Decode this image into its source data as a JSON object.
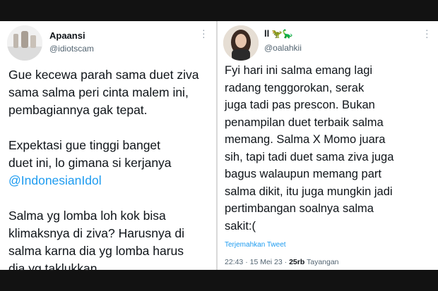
{
  "left_tweet": {
    "name": "Apaansi",
    "handle": "@idiotscam",
    "more_icon": "more-vertical-icon",
    "paragraphs": {
      "p1": [
        "Gue kecewa parah sama duet ziva",
        "sama salma peri cinta malem ini,",
        "pembagiannya gak tepat."
      ],
      "p2": [
        "Expektasi gue tinggi banget",
        "duet ini, lo gimana si kerjanya"
      ],
      "mention": "@IndonesianIdol",
      "p3": [
        "Salma yg lomba loh kok bisa",
        "klimaksnya di ziva? Harusnya di",
        "salma karna dia yg lomba harus",
        "dia yg taklukkan"
      ]
    }
  },
  "right_tweet": {
    "name": "ll",
    "name_emoji": "🦖🦕",
    "handle": "@oalahkii",
    "more_icon": "more-vertical-icon",
    "lines": [
      "Fyi hari ini salma emang lagi",
      "radang tenggorokan, serak",
      "juga tadi pas prescon. Bukan",
      "penampilan duet terbaik salma",
      "memang. Salma X Momo juara",
      "sih, tapi tadi duet sama ziva juga",
      "bagus walaupun memang part",
      "salma dikit, itu juga mungkin jadi",
      "pertimbangan soalnya salma",
      "sakit:("
    ],
    "translate_label": "Terjemahkan Tweet",
    "timestamp": "22:43 · 15 Mei 23 · ",
    "views_count": "25rb",
    "views_label": " Tayangan"
  },
  "colors": {
    "link": "#1d9bf0",
    "text": "#0f1419",
    "secondary": "#536471"
  }
}
